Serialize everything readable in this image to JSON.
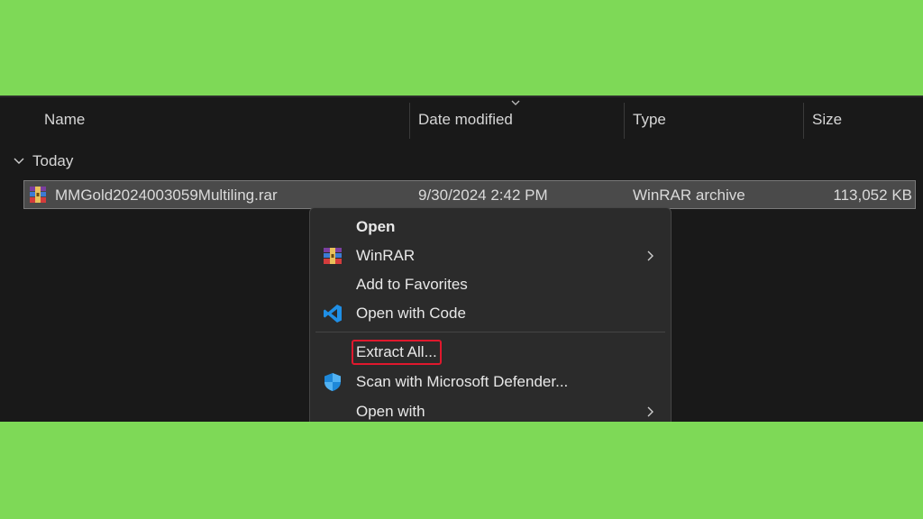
{
  "columns": {
    "name": "Name",
    "date_modified": "Date modified",
    "type": "Type",
    "size": "Size"
  },
  "group": {
    "label": "Today",
    "icon": "chevron-down-icon"
  },
  "file": {
    "name": "MMGold2024003059Multiling.rar",
    "date_modified": "9/30/2024 2:42 PM",
    "type": "WinRAR archive",
    "size": "113,052 KB",
    "icon": "winrar-archive-icon"
  },
  "context_menu": {
    "items": [
      {
        "label": "Open",
        "icon": "",
        "submenu": false
      },
      {
        "label": "WinRAR",
        "icon": "winrar-icon",
        "submenu": true
      },
      {
        "label": "Add to Favorites",
        "icon": "",
        "submenu": false
      },
      {
        "label": "Open with Code",
        "icon": "vscode-icon",
        "submenu": false
      },
      {
        "label": "Extract All...",
        "icon": "",
        "submenu": false,
        "highlighted": true
      },
      {
        "label": "Scan with Microsoft Defender...",
        "icon": "defender-shield-icon",
        "submenu": false
      },
      {
        "label": "Open with",
        "icon": "",
        "submenu": true
      }
    ]
  },
  "colors": {
    "background": "#7ed957",
    "explorer_bg": "#191919",
    "menu_bg": "#2b2b2b",
    "highlight_border": "#e0182d"
  }
}
